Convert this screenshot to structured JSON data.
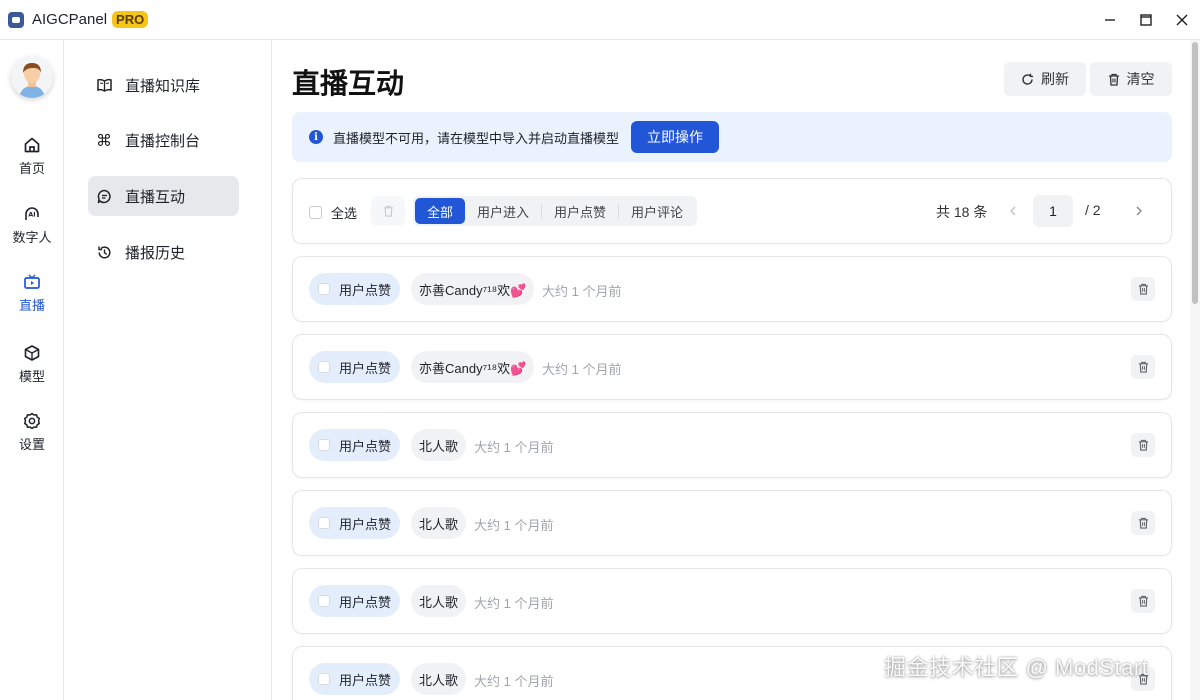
{
  "app": {
    "name": "AIGCPanel",
    "badge": "PRO"
  },
  "window_controls": {
    "minimize": "—",
    "maximize": "□",
    "close": "✕"
  },
  "rail": {
    "items": [
      {
        "label": "首页",
        "icon": "home-icon"
      },
      {
        "label": "数字人",
        "icon": "ai-avatar-icon"
      },
      {
        "label": "直播",
        "icon": "live-tv-icon",
        "active": true
      },
      {
        "label": "模型",
        "icon": "cube-icon"
      },
      {
        "label": "设置",
        "icon": "gear-icon"
      }
    ]
  },
  "subnav": {
    "items": [
      {
        "label": "直播知识库",
        "icon": "book-icon"
      },
      {
        "label": "直播控制台",
        "icon": "command-icon"
      },
      {
        "label": "直播互动",
        "icon": "chat-bubble-icon",
        "active": true
      },
      {
        "label": "播报历史",
        "icon": "history-icon"
      }
    ]
  },
  "page": {
    "title": "直播互动",
    "refresh_label": "刷新",
    "clear_label": "清空"
  },
  "alert": {
    "message": "直播模型不可用，请在模型中导入并启动直播模型",
    "action_label": "立即操作"
  },
  "toolbar": {
    "select_all_label": "全选",
    "filters": [
      "全部",
      "用户进入",
      "用户点赞",
      "用户评论"
    ],
    "active_filter": "全部",
    "total_text": "共 18 条",
    "current_page": "1",
    "page_total_text": "/  2"
  },
  "rows": [
    {
      "type": "用户点赞",
      "user": "亦善Candy⁷¹⁸欢💕",
      "time": "大约 1 个月前"
    },
    {
      "type": "用户点赞",
      "user": "亦善Candy⁷¹⁸欢💕",
      "time": "大约 1 个月前"
    },
    {
      "type": "用户点赞",
      "user": "北人歌",
      "time": "大约 1 个月前"
    },
    {
      "type": "用户点赞",
      "user": "北人歌",
      "time": "大约 1 个月前"
    },
    {
      "type": "用户点赞",
      "user": "北人歌",
      "time": "大约 1 个月前"
    },
    {
      "type": "用户点赞",
      "user": "北人歌",
      "time": "大约 1 个月前"
    }
  ],
  "watermark": "掘金技术社区 @ ModStart",
  "colors": {
    "accent": "#2156d6",
    "alert_bg": "#eaf2fd",
    "pro_badge": "#f5c518"
  }
}
